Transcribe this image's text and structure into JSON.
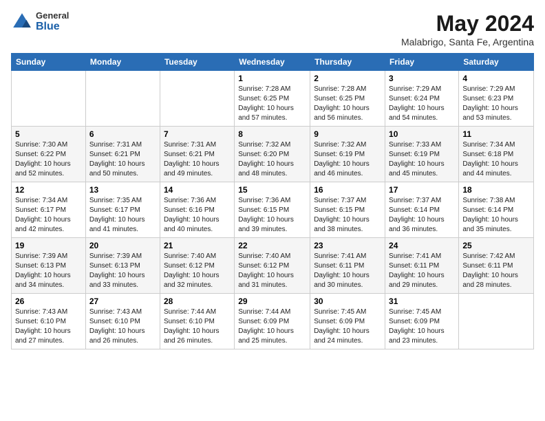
{
  "logo": {
    "general": "General",
    "blue": "Blue"
  },
  "header": {
    "month_year": "May 2024",
    "location": "Malabrigo, Santa Fe, Argentina"
  },
  "weekdays": [
    "Sunday",
    "Monday",
    "Tuesday",
    "Wednesday",
    "Thursday",
    "Friday",
    "Saturday"
  ],
  "weeks": [
    [
      {
        "day": "",
        "info": ""
      },
      {
        "day": "",
        "info": ""
      },
      {
        "day": "",
        "info": ""
      },
      {
        "day": "1",
        "info": "Sunrise: 7:28 AM\nSunset: 6:25 PM\nDaylight: 10 hours and 57 minutes."
      },
      {
        "day": "2",
        "info": "Sunrise: 7:28 AM\nSunset: 6:25 PM\nDaylight: 10 hours and 56 minutes."
      },
      {
        "day": "3",
        "info": "Sunrise: 7:29 AM\nSunset: 6:24 PM\nDaylight: 10 hours and 54 minutes."
      },
      {
        "day": "4",
        "info": "Sunrise: 7:29 AM\nSunset: 6:23 PM\nDaylight: 10 hours and 53 minutes."
      }
    ],
    [
      {
        "day": "5",
        "info": "Sunrise: 7:30 AM\nSunset: 6:22 PM\nDaylight: 10 hours and 52 minutes."
      },
      {
        "day": "6",
        "info": "Sunrise: 7:31 AM\nSunset: 6:21 PM\nDaylight: 10 hours and 50 minutes."
      },
      {
        "day": "7",
        "info": "Sunrise: 7:31 AM\nSunset: 6:21 PM\nDaylight: 10 hours and 49 minutes."
      },
      {
        "day": "8",
        "info": "Sunrise: 7:32 AM\nSunset: 6:20 PM\nDaylight: 10 hours and 48 minutes."
      },
      {
        "day": "9",
        "info": "Sunrise: 7:32 AM\nSunset: 6:19 PM\nDaylight: 10 hours and 46 minutes."
      },
      {
        "day": "10",
        "info": "Sunrise: 7:33 AM\nSunset: 6:19 PM\nDaylight: 10 hours and 45 minutes."
      },
      {
        "day": "11",
        "info": "Sunrise: 7:34 AM\nSunset: 6:18 PM\nDaylight: 10 hours and 44 minutes."
      }
    ],
    [
      {
        "day": "12",
        "info": "Sunrise: 7:34 AM\nSunset: 6:17 PM\nDaylight: 10 hours and 42 minutes."
      },
      {
        "day": "13",
        "info": "Sunrise: 7:35 AM\nSunset: 6:17 PM\nDaylight: 10 hours and 41 minutes."
      },
      {
        "day": "14",
        "info": "Sunrise: 7:36 AM\nSunset: 6:16 PM\nDaylight: 10 hours and 40 minutes."
      },
      {
        "day": "15",
        "info": "Sunrise: 7:36 AM\nSunset: 6:15 PM\nDaylight: 10 hours and 39 minutes."
      },
      {
        "day": "16",
        "info": "Sunrise: 7:37 AM\nSunset: 6:15 PM\nDaylight: 10 hours and 38 minutes."
      },
      {
        "day": "17",
        "info": "Sunrise: 7:37 AM\nSunset: 6:14 PM\nDaylight: 10 hours and 36 minutes."
      },
      {
        "day": "18",
        "info": "Sunrise: 7:38 AM\nSunset: 6:14 PM\nDaylight: 10 hours and 35 minutes."
      }
    ],
    [
      {
        "day": "19",
        "info": "Sunrise: 7:39 AM\nSunset: 6:13 PM\nDaylight: 10 hours and 34 minutes."
      },
      {
        "day": "20",
        "info": "Sunrise: 7:39 AM\nSunset: 6:13 PM\nDaylight: 10 hours and 33 minutes."
      },
      {
        "day": "21",
        "info": "Sunrise: 7:40 AM\nSunset: 6:12 PM\nDaylight: 10 hours and 32 minutes."
      },
      {
        "day": "22",
        "info": "Sunrise: 7:40 AM\nSunset: 6:12 PM\nDaylight: 10 hours and 31 minutes."
      },
      {
        "day": "23",
        "info": "Sunrise: 7:41 AM\nSunset: 6:11 PM\nDaylight: 10 hours and 30 minutes."
      },
      {
        "day": "24",
        "info": "Sunrise: 7:41 AM\nSunset: 6:11 PM\nDaylight: 10 hours and 29 minutes."
      },
      {
        "day": "25",
        "info": "Sunrise: 7:42 AM\nSunset: 6:11 PM\nDaylight: 10 hours and 28 minutes."
      }
    ],
    [
      {
        "day": "26",
        "info": "Sunrise: 7:43 AM\nSunset: 6:10 PM\nDaylight: 10 hours and 27 minutes."
      },
      {
        "day": "27",
        "info": "Sunrise: 7:43 AM\nSunset: 6:10 PM\nDaylight: 10 hours and 26 minutes."
      },
      {
        "day": "28",
        "info": "Sunrise: 7:44 AM\nSunset: 6:10 PM\nDaylight: 10 hours and 26 minutes."
      },
      {
        "day": "29",
        "info": "Sunrise: 7:44 AM\nSunset: 6:09 PM\nDaylight: 10 hours and 25 minutes."
      },
      {
        "day": "30",
        "info": "Sunrise: 7:45 AM\nSunset: 6:09 PM\nDaylight: 10 hours and 24 minutes."
      },
      {
        "day": "31",
        "info": "Sunrise: 7:45 AM\nSunset: 6:09 PM\nDaylight: 10 hours and 23 minutes."
      },
      {
        "day": "",
        "info": ""
      }
    ]
  ]
}
